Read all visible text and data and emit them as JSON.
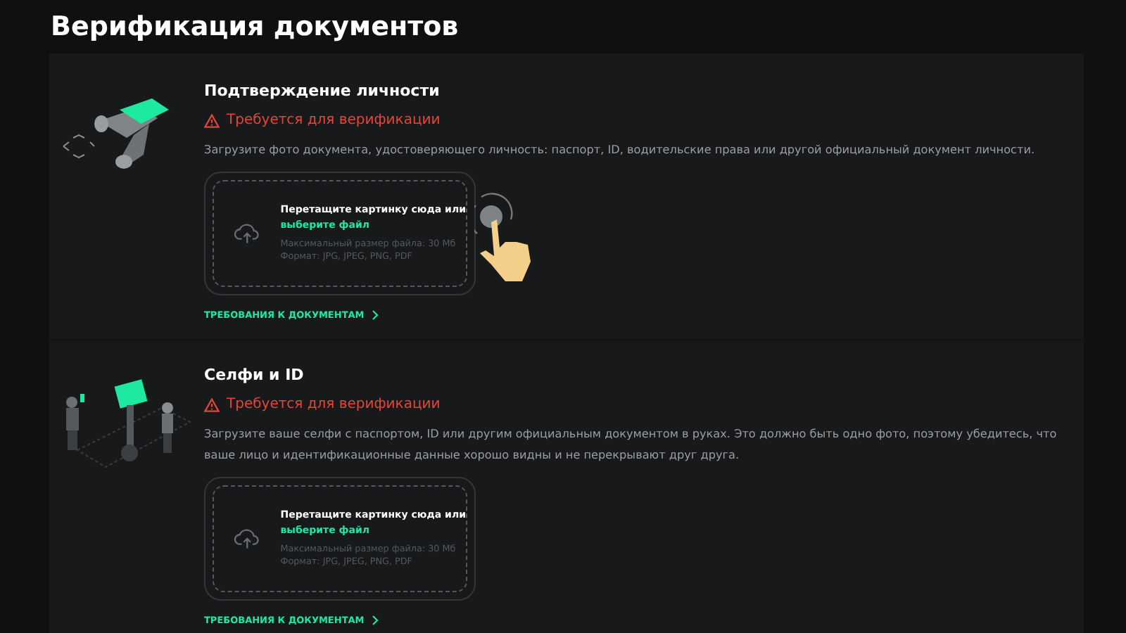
{
  "page": {
    "title": "Верификация документов"
  },
  "sections": [
    {
      "kind": "id",
      "title": "Подтверждение личности",
      "status": "Требуется для верификации",
      "description": "Загрузите фото документа, удостоверяющего личность: паспорт, ID, водительские права или другой официальный документ личности.",
      "upload": {
        "prompt": "Перетащите картинку сюда или",
        "link": "выберите файл",
        "max_size": "Максимальный размер файла: 30 Мб",
        "formats": "Формат: JPG, JPEG, PNG, PDF",
        "cursor": true
      },
      "requirements_link": "ТРЕБОВАНИЯ К ДОКУМЕНТАМ"
    },
    {
      "kind": "selfie",
      "title": "Селфи и ID",
      "status": "Требуется для верификации",
      "description": "Загрузите ваше селфи с паспортом, ID или другим официальным документом в руках. Это должно быть одно фото, поэтому убедитесь, что ваше лицо и идентификационные данные хорошо видны и не перекрывают друг друга.",
      "upload": {
        "prompt": "Перетащите картинку сюда или",
        "link": "выберите файл",
        "max_size": "Максимальный размер файла: 30 Мб",
        "formats": "Формат: JPG, JPEG, PNG, PDF",
        "cursor": false
      },
      "requirements_link": "ТРЕБОВАНИЯ К ДОКУМЕНТАМ"
    }
  ]
}
